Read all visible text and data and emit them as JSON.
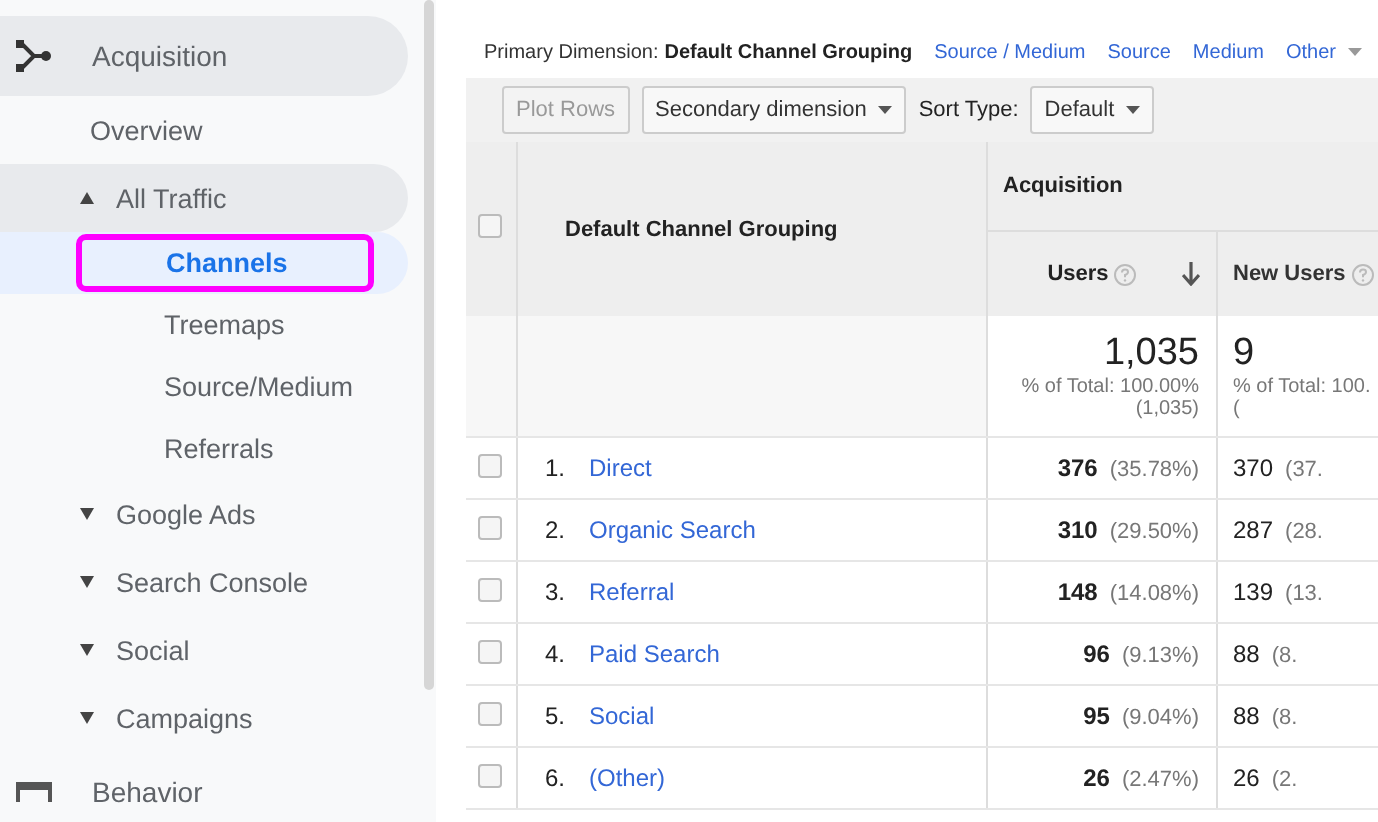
{
  "sidebar": {
    "items": [
      {
        "label": "Acquisition",
        "expanded": true,
        "selected": false,
        "children": [
          {
            "label": "Overview",
            "selected": false
          },
          {
            "label": "All Traffic",
            "expanded": true,
            "selected": false,
            "children": [
              {
                "label": "Channels",
                "selected": true,
                "highlighted": true
              },
              {
                "label": "Treemaps",
                "selected": false
              },
              {
                "label": "Source/Medium",
                "selected": false
              },
              {
                "label": "Referrals",
                "selected": false
              }
            ]
          },
          {
            "label": "Google Ads",
            "expanded": false,
            "selected": false
          },
          {
            "label": "Search Console",
            "expanded": false,
            "selected": false
          },
          {
            "label": "Social",
            "expanded": false,
            "selected": false
          },
          {
            "label": "Campaigns",
            "expanded": false,
            "selected": false
          }
        ]
      },
      {
        "label": "Behavior",
        "selected": false
      }
    ]
  },
  "primary_dimension": {
    "label": "Primary Dimension:",
    "options": [
      {
        "label": "Default Channel Grouping",
        "selected": true
      },
      {
        "label": "Source / Medium",
        "selected": false
      },
      {
        "label": "Source",
        "selected": false
      },
      {
        "label": "Medium",
        "selected": false
      },
      {
        "label": "Other",
        "selected": false,
        "kind": "menu"
      }
    ]
  },
  "toolbar": {
    "plot_rows": {
      "label": "Plot Rows",
      "disabled": true
    },
    "secondary_dimension": "Secondary dimension",
    "sort_type_label": "Sort Type:",
    "sort_type": "Default"
  },
  "table": {
    "select_all": {
      "checked": false
    },
    "dimension_header": "Default Channel Grouping",
    "group_header": "Acquisition",
    "columns": [
      {
        "label": "Users",
        "sorted": true
      },
      {
        "label": "New Users",
        "sorted": false
      }
    ],
    "totals": [
      {
        "value": "1,035",
        "share": "% of Total: 100.00%",
        "total": "(1,035)"
      },
      {
        "value": "9",
        "share": "% of Total: 100.",
        "total": "("
      }
    ],
    "rows": [
      {
        "rank": "1.",
        "name": "Direct",
        "checked": false,
        "cells": [
          {
            "value": "376",
            "pct": "(35.78%)"
          },
          {
            "value": "370",
            "pct": "(37."
          }
        ]
      },
      {
        "rank": "2.",
        "name": "Organic Search",
        "checked": false,
        "cells": [
          {
            "value": "310",
            "pct": "(29.50%)"
          },
          {
            "value": "287",
            "pct": "(28."
          }
        ]
      },
      {
        "rank": "3.",
        "name": "Referral",
        "checked": false,
        "cells": [
          {
            "value": "148",
            "pct": "(14.08%)"
          },
          {
            "value": "139",
            "pct": "(13."
          }
        ]
      },
      {
        "rank": "4.",
        "name": "Paid Search",
        "checked": false,
        "cells": [
          {
            "value": "96",
            "pct": "(9.13%)"
          },
          {
            "value": "88",
            "pct": "(8."
          }
        ]
      },
      {
        "rank": "5.",
        "name": "Social",
        "checked": false,
        "cells": [
          {
            "value": "95",
            "pct": "(9.04%)"
          },
          {
            "value": "88",
            "pct": "(8."
          }
        ]
      },
      {
        "rank": "6.",
        "name": "(Other)",
        "checked": false,
        "cells": [
          {
            "value": "26",
            "pct": "(2.47%)"
          },
          {
            "value": "26",
            "pct": "(2."
          }
        ]
      }
    ]
  }
}
